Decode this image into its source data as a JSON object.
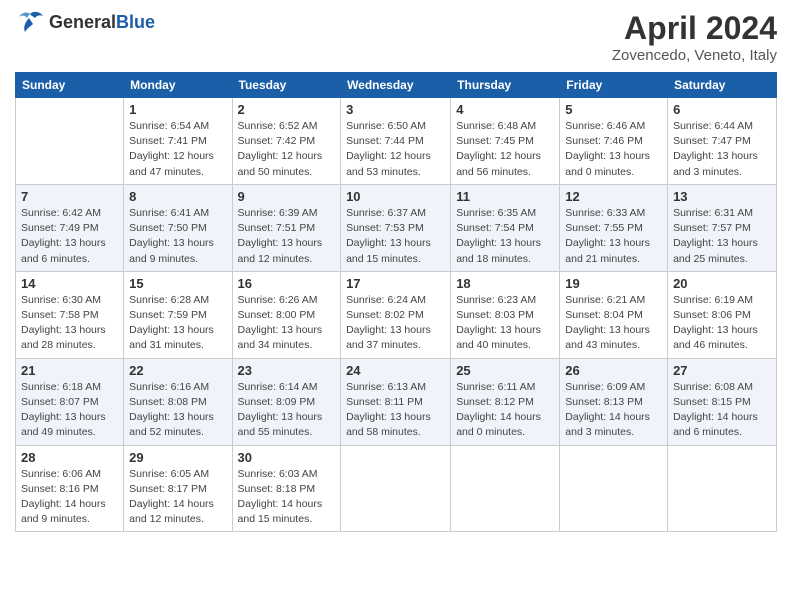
{
  "header": {
    "logo_general": "General",
    "logo_blue": "Blue",
    "title": "April 2024",
    "subtitle": "Zovencedo, Veneto, Italy"
  },
  "columns": [
    "Sunday",
    "Monday",
    "Tuesday",
    "Wednesday",
    "Thursday",
    "Friday",
    "Saturday"
  ],
  "weeks": [
    [
      {
        "day": "",
        "info": ""
      },
      {
        "day": "1",
        "info": "Sunrise: 6:54 AM\nSunset: 7:41 PM\nDaylight: 12 hours\nand 47 minutes."
      },
      {
        "day": "2",
        "info": "Sunrise: 6:52 AM\nSunset: 7:42 PM\nDaylight: 12 hours\nand 50 minutes."
      },
      {
        "day": "3",
        "info": "Sunrise: 6:50 AM\nSunset: 7:44 PM\nDaylight: 12 hours\nand 53 minutes."
      },
      {
        "day": "4",
        "info": "Sunrise: 6:48 AM\nSunset: 7:45 PM\nDaylight: 12 hours\nand 56 minutes."
      },
      {
        "day": "5",
        "info": "Sunrise: 6:46 AM\nSunset: 7:46 PM\nDaylight: 13 hours\nand 0 minutes."
      },
      {
        "day": "6",
        "info": "Sunrise: 6:44 AM\nSunset: 7:47 PM\nDaylight: 13 hours\nand 3 minutes."
      }
    ],
    [
      {
        "day": "7",
        "info": "Sunrise: 6:42 AM\nSunset: 7:49 PM\nDaylight: 13 hours\nand 6 minutes."
      },
      {
        "day": "8",
        "info": "Sunrise: 6:41 AM\nSunset: 7:50 PM\nDaylight: 13 hours\nand 9 minutes."
      },
      {
        "day": "9",
        "info": "Sunrise: 6:39 AM\nSunset: 7:51 PM\nDaylight: 13 hours\nand 12 minutes."
      },
      {
        "day": "10",
        "info": "Sunrise: 6:37 AM\nSunset: 7:53 PM\nDaylight: 13 hours\nand 15 minutes."
      },
      {
        "day": "11",
        "info": "Sunrise: 6:35 AM\nSunset: 7:54 PM\nDaylight: 13 hours\nand 18 minutes."
      },
      {
        "day": "12",
        "info": "Sunrise: 6:33 AM\nSunset: 7:55 PM\nDaylight: 13 hours\nand 21 minutes."
      },
      {
        "day": "13",
        "info": "Sunrise: 6:31 AM\nSunset: 7:57 PM\nDaylight: 13 hours\nand 25 minutes."
      }
    ],
    [
      {
        "day": "14",
        "info": "Sunrise: 6:30 AM\nSunset: 7:58 PM\nDaylight: 13 hours\nand 28 minutes."
      },
      {
        "day": "15",
        "info": "Sunrise: 6:28 AM\nSunset: 7:59 PM\nDaylight: 13 hours\nand 31 minutes."
      },
      {
        "day": "16",
        "info": "Sunrise: 6:26 AM\nSunset: 8:00 PM\nDaylight: 13 hours\nand 34 minutes."
      },
      {
        "day": "17",
        "info": "Sunrise: 6:24 AM\nSunset: 8:02 PM\nDaylight: 13 hours\nand 37 minutes."
      },
      {
        "day": "18",
        "info": "Sunrise: 6:23 AM\nSunset: 8:03 PM\nDaylight: 13 hours\nand 40 minutes."
      },
      {
        "day": "19",
        "info": "Sunrise: 6:21 AM\nSunset: 8:04 PM\nDaylight: 13 hours\nand 43 minutes."
      },
      {
        "day": "20",
        "info": "Sunrise: 6:19 AM\nSunset: 8:06 PM\nDaylight: 13 hours\nand 46 minutes."
      }
    ],
    [
      {
        "day": "21",
        "info": "Sunrise: 6:18 AM\nSunset: 8:07 PM\nDaylight: 13 hours\nand 49 minutes."
      },
      {
        "day": "22",
        "info": "Sunrise: 6:16 AM\nSunset: 8:08 PM\nDaylight: 13 hours\nand 52 minutes."
      },
      {
        "day": "23",
        "info": "Sunrise: 6:14 AM\nSunset: 8:09 PM\nDaylight: 13 hours\nand 55 minutes."
      },
      {
        "day": "24",
        "info": "Sunrise: 6:13 AM\nSunset: 8:11 PM\nDaylight: 13 hours\nand 58 minutes."
      },
      {
        "day": "25",
        "info": "Sunrise: 6:11 AM\nSunset: 8:12 PM\nDaylight: 14 hours\nand 0 minutes."
      },
      {
        "day": "26",
        "info": "Sunrise: 6:09 AM\nSunset: 8:13 PM\nDaylight: 14 hours\nand 3 minutes."
      },
      {
        "day": "27",
        "info": "Sunrise: 6:08 AM\nSunset: 8:15 PM\nDaylight: 14 hours\nand 6 minutes."
      }
    ],
    [
      {
        "day": "28",
        "info": "Sunrise: 6:06 AM\nSunset: 8:16 PM\nDaylight: 14 hours\nand 9 minutes."
      },
      {
        "day": "29",
        "info": "Sunrise: 6:05 AM\nSunset: 8:17 PM\nDaylight: 14 hours\nand 12 minutes."
      },
      {
        "day": "30",
        "info": "Sunrise: 6:03 AM\nSunset: 8:18 PM\nDaylight: 14 hours\nand 15 minutes."
      },
      {
        "day": "",
        "info": ""
      },
      {
        "day": "",
        "info": ""
      },
      {
        "day": "",
        "info": ""
      },
      {
        "day": "",
        "info": ""
      }
    ]
  ]
}
